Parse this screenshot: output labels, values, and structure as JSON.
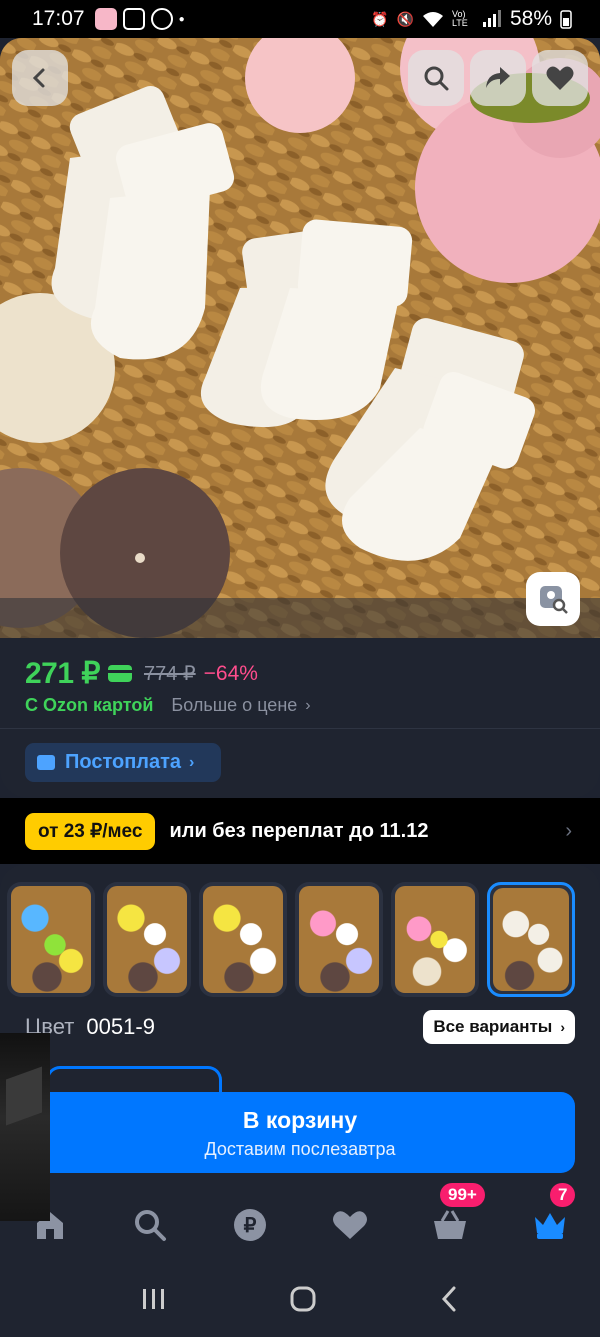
{
  "status_bar": {
    "time": "17:07",
    "battery": "58%",
    "signal_text": "Vo) LTE"
  },
  "product": {
    "image_alt_icon": "socks-photo",
    "back_icon": "chevron-left-icon",
    "search_icon": "search-icon",
    "share_icon": "share-arrow-icon",
    "favorite_icon": "heart-icon",
    "lens_icon": "visual-search-icon"
  },
  "price": {
    "current": "271 ₽",
    "old": "774 ₽",
    "discount": "−64%",
    "ozon_card_label": "С Ozon картой",
    "more_label": "Больше о цене",
    "postpay_label": "Постоплата"
  },
  "installment": {
    "badge": "от 23 ₽/мес",
    "text": "или без переплат до 11.12"
  },
  "variants": {
    "thumbnails": [
      {
        "label": "variant-1"
      },
      {
        "label": "variant-2"
      },
      {
        "label": "variant-3"
      },
      {
        "label": "variant-4"
      },
      {
        "label": "variant-5"
      },
      {
        "label": "variant-6"
      }
    ],
    "color_label": "Цвет",
    "color_value": "0051-9",
    "all_variants": "Все варианты"
  },
  "cart": {
    "title": "В корзину",
    "subtitle": "Доставим послезавтра"
  },
  "bottom_nav": {
    "items": [
      {
        "icon": "home-icon"
      },
      {
        "icon": "search-icon"
      },
      {
        "icon": "ruble-icon"
      },
      {
        "icon": "heart-icon"
      },
      {
        "icon": "basket-icon",
        "badge": "99+"
      },
      {
        "icon": "crown-icon",
        "badge": "7"
      }
    ]
  },
  "colors": {
    "accent_blue": "#0077ff",
    "price_green": "#3fd35a",
    "discount_pink": "#ff4d8d",
    "badge_pink": "#f91e6e",
    "installment_yellow": "#ffcc00"
  }
}
